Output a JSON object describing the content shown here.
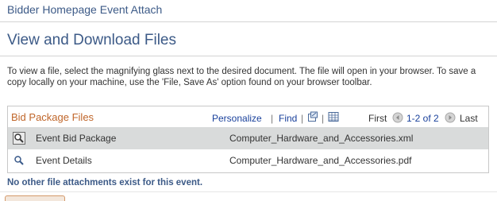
{
  "header": {
    "title": "Bidder Homepage Event Attach"
  },
  "section": {
    "title": "View and Download Files"
  },
  "instructions": "To view a file, select the magnifying glass next to the desired document.  The file will open in your browser.  To save a copy locally on your machine, use the 'File, Save As' option found on your browser toolbar.",
  "grid": {
    "title": "Bid Package Files",
    "personalize": "Personalize",
    "find": "Find",
    "first": "First",
    "range": "1-2 of 2",
    "last": "Last",
    "separator": "|",
    "rows": [
      {
        "description": "Event Bid Package",
        "file": "Computer_Hardware_and_Accessories.xml",
        "icon": "magnifying-glass-icon"
      },
      {
        "description": "Event Details",
        "file": "Computer_Hardware_and_Accessories.pdf",
        "icon": "magnifying-glass-icon"
      }
    ]
  },
  "footer_note": "No other file attachments exist for this event.",
  "colors": {
    "title_blue": "#3c5a87",
    "grid_title_orange": "#c0662a",
    "link_blue": "#19409b",
    "row_alt": "#d9dbdb"
  }
}
